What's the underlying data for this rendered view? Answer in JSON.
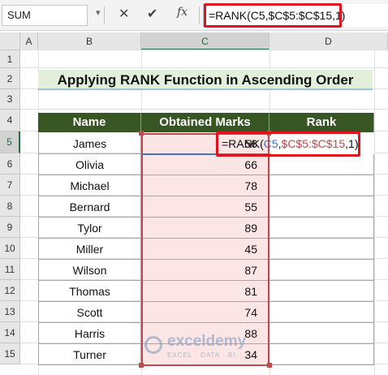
{
  "formula_bar": {
    "name_box": "SUM",
    "cancel_icon": "x-icon",
    "enter_icon": "check-icon",
    "fx_label": "fx",
    "formula": "=RANK(C5,$C$5:$C$15,1)"
  },
  "columns": [
    "A",
    "B",
    "C",
    "D"
  ],
  "rows": [
    "1",
    "2",
    "3",
    "4",
    "5",
    "6",
    "7",
    "8",
    "9",
    "10",
    "11",
    "12",
    "13",
    "14",
    "15"
  ],
  "title": "Applying RANK Function in Ascending Order",
  "table": {
    "headers": [
      "Name",
      "Obtained Marks",
      "Rank"
    ],
    "rows": [
      {
        "name": "James",
        "marks": "56"
      },
      {
        "name": "Olivia",
        "marks": "66"
      },
      {
        "name": "Michael",
        "marks": "78"
      },
      {
        "name": "Bernard",
        "marks": "55"
      },
      {
        "name": "Tylor",
        "marks": "89"
      },
      {
        "name": "Miller",
        "marks": "45"
      },
      {
        "name": "Wilson",
        "marks": "87"
      },
      {
        "name": "Thomas",
        "marks": "81"
      },
      {
        "name": "Scott",
        "marks": "74"
      },
      {
        "name": "Harris",
        "marks": "88"
      },
      {
        "name": "Turner",
        "marks": "34"
      }
    ]
  },
  "edit_cell": {
    "prefix": "=RANK(",
    "ref1": "C5",
    "comma1": ",",
    "ref2": "$C$5:$C$15",
    "suffix": ",1)"
  },
  "watermark": {
    "name": "exceldemy",
    "tagline": "EXCEL · DATA · BI"
  },
  "colors": {
    "header_fill": "#375623",
    "title_fill": "#e2efda",
    "range_fill": "#fbe5e5",
    "highlight": "#e0141e"
  }
}
